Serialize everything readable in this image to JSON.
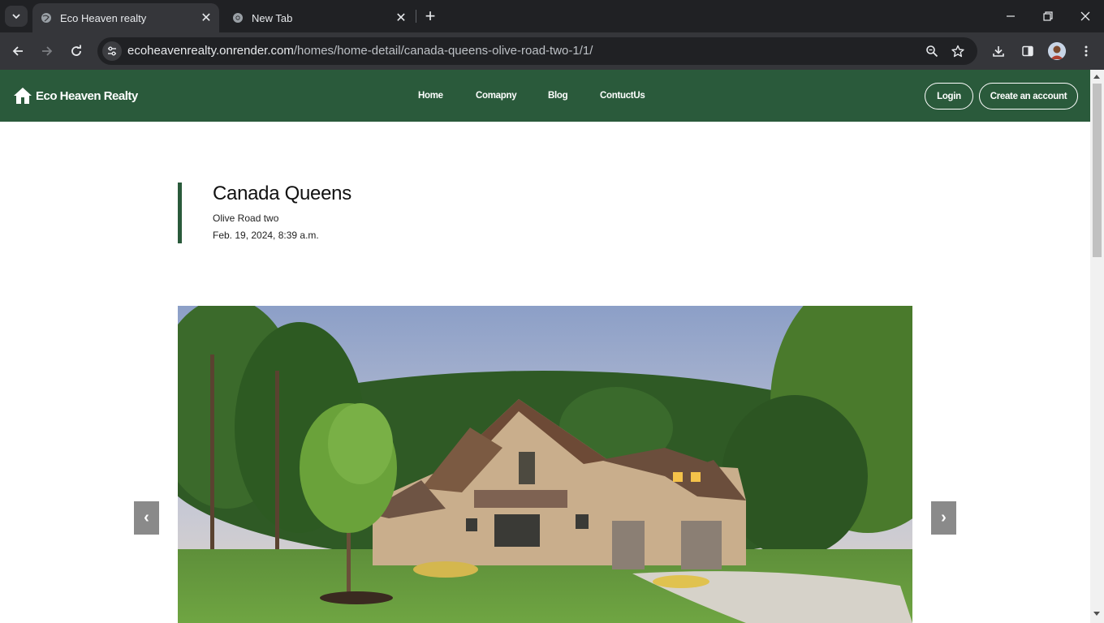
{
  "browser": {
    "tabs": [
      {
        "title": "Eco Heaven realty",
        "active": true
      },
      {
        "title": "New Tab",
        "active": false
      }
    ],
    "url_host": "ecoheavenrealty.onrender.com",
    "url_path": "/homes/home-detail/canada-queens-olive-road-two-1/1/"
  },
  "site": {
    "brand": "Eco Heaven Realty",
    "nav": [
      "Home",
      "Comapny",
      "Blog",
      "ContuctUs"
    ],
    "login_label": "Login",
    "signup_label": "Create an account",
    "accent_color": "#2a5a3b"
  },
  "listing": {
    "title": "Canada Queens",
    "address": "Olive Road two",
    "date": "Feb. 19, 2024, 8:39 a.m."
  },
  "carousel": {
    "prev_label": "‹",
    "next_label": "›"
  }
}
